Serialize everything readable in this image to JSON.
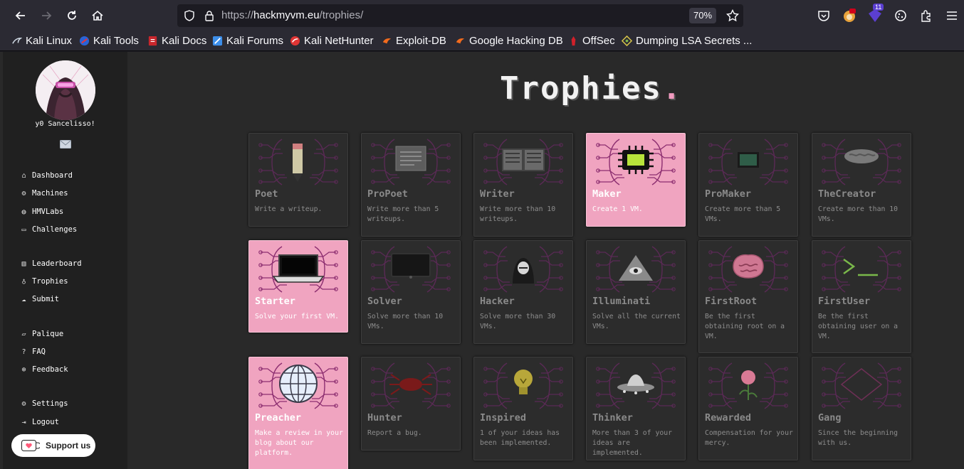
{
  "browser": {
    "url_prefix": "https://",
    "url_host": "hackmyvm.eu",
    "url_path": "/trophies/",
    "zoom": "70%",
    "badge_count": "11",
    "bookmarks": [
      "Kali Linux",
      "Kali Tools",
      "Kali Docs",
      "Kali Forums",
      "Kali NetHunter",
      "Exploit-DB",
      "Google Hacking DB",
      "OffSec",
      "Dumping LSA Secrets ..."
    ]
  },
  "sidebar": {
    "greeting": "y0 Sancelisso!",
    "nav": [
      {
        "label": "Dashboard",
        "icon": "home-icon"
      },
      {
        "label": "Machines",
        "icon": "gear-icon"
      },
      {
        "label": "HMVLabs",
        "icon": "gamepad-icon"
      },
      {
        "label": "Challenges",
        "icon": "chat-icon"
      },
      {
        "label": "Leaderboard",
        "icon": "chart-icon"
      },
      {
        "label": "Trophies",
        "icon": "trophy-icon"
      },
      {
        "label": "Submit",
        "icon": "upload-icon"
      },
      {
        "label": "Palique",
        "icon": "message-icon"
      },
      {
        "label": "FAQ",
        "icon": "question-icon"
      },
      {
        "label": "Feedback",
        "icon": "feedback-icon"
      },
      {
        "label": "Settings",
        "icon": "gear-icon"
      },
      {
        "label": "Logout",
        "icon": "logout-icon"
      }
    ],
    "support_label": "Support us"
  },
  "page": {
    "title": "Trophies",
    "title_dot": "."
  },
  "trophies": [
    {
      "name": "Poet",
      "desc": "Write a writeup.",
      "earned": false,
      "icon": "pencil-icon"
    },
    {
      "name": "ProPoet",
      "desc": "Write more than 5 writeups.",
      "earned": false,
      "icon": "document-icon"
    },
    {
      "name": "Writer",
      "desc": "Write more than 10 writeups.",
      "earned": false,
      "icon": "book-icon"
    },
    {
      "name": "Maker",
      "desc": "Create 1 VM.",
      "earned": true,
      "icon": "chip-icon"
    },
    {
      "name": "ProMaker",
      "desc": "Create more than 5 VMs.",
      "earned": false,
      "icon": "screen-icon"
    },
    {
      "name": "TheCreator",
      "desc": "Create more than 10 VMs.",
      "earned": false,
      "icon": "brain-icon"
    },
    {
      "name": "Starter",
      "desc": "Solve your first VM.",
      "earned": true,
      "icon": "laptop-icon"
    },
    {
      "name": "Solver",
      "desc": "Solve more than 10 VMs.",
      "earned": false,
      "icon": "monitor-icon"
    },
    {
      "name": "Hacker",
      "desc": "Solve more than 30 VMs.",
      "earned": false,
      "icon": "hacker-icon"
    },
    {
      "name": "Illuminati",
      "desc": "Solve all the current VMs.",
      "earned": false,
      "icon": "pyramid-icon"
    },
    {
      "name": "FirstRoot",
      "desc": "Be the first obtaining root on a VM.",
      "earned": false,
      "icon": "brain-pink-icon"
    },
    {
      "name": "FirstUser",
      "desc": "Be the first obtaining user on a VM.",
      "earned": false,
      "icon": "terminal-icon"
    },
    {
      "name": "Preacher",
      "desc": "Make a review in your blog about our platform.",
      "earned": true,
      "icon": "globe-icon"
    },
    {
      "name": "Hunter",
      "desc": "Report a bug.",
      "earned": false,
      "icon": "bug-icon"
    },
    {
      "name": "Inspired",
      "desc": "1 of your ideas has been implemented.",
      "earned": false,
      "icon": "bulb-icon"
    },
    {
      "name": "Thinker",
      "desc": "More than 3 of your ideas are implemented.",
      "earned": false,
      "icon": "ufo-icon"
    },
    {
      "name": "Rewarded",
      "desc": "Compensation for your mercy.",
      "earned": false,
      "icon": "rose-icon"
    },
    {
      "name": "Gang",
      "desc": "Since the beginning with us.",
      "earned": false,
      "icon": "diamond-icon"
    }
  ]
}
